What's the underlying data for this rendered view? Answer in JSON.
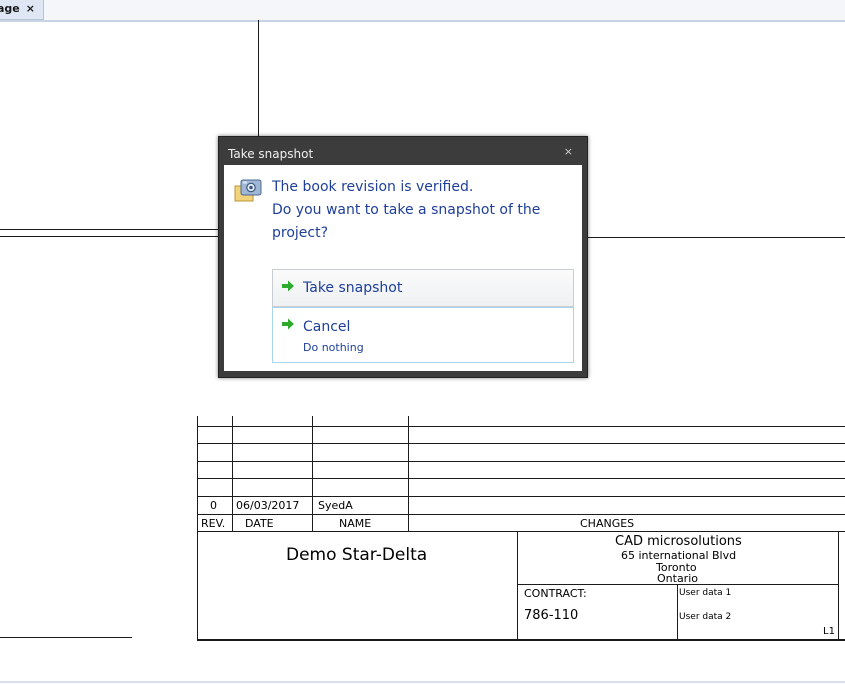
{
  "tab": {
    "label": "age",
    "close": "×"
  },
  "dialog": {
    "title": "Take snapshot",
    "close": "×",
    "message_lines": [
      "The book revision is verified.",
      "Do you want to take a snapshot of the",
      "project?"
    ],
    "primary": {
      "label": "Take snapshot"
    },
    "secondary": {
      "label": "Cancel",
      "note": "Do nothing"
    }
  },
  "revision_table": {
    "row": {
      "rev": "0",
      "date": "06/03/2017",
      "name": "SyedA"
    },
    "headers": {
      "rev": "REV.",
      "date": "DATE",
      "name": "NAME",
      "changes": "CHANGES"
    }
  },
  "title_block": {
    "project_title": "Demo Star-Delta",
    "company": "CAD microsolutions",
    "address": [
      "65 international Blvd",
      "Toronto",
      "Ontario"
    ],
    "contract_label": "CONTRACT:",
    "contract_value": "786-110",
    "user_data_1": "User data 1",
    "user_data_2": "User data 2",
    "sheet_ref": "L1"
  },
  "colors": {
    "dialog_frame": "#3c3c3c",
    "dialog_text": "#1f3f99",
    "arrow_green": "#2eaa2e"
  }
}
